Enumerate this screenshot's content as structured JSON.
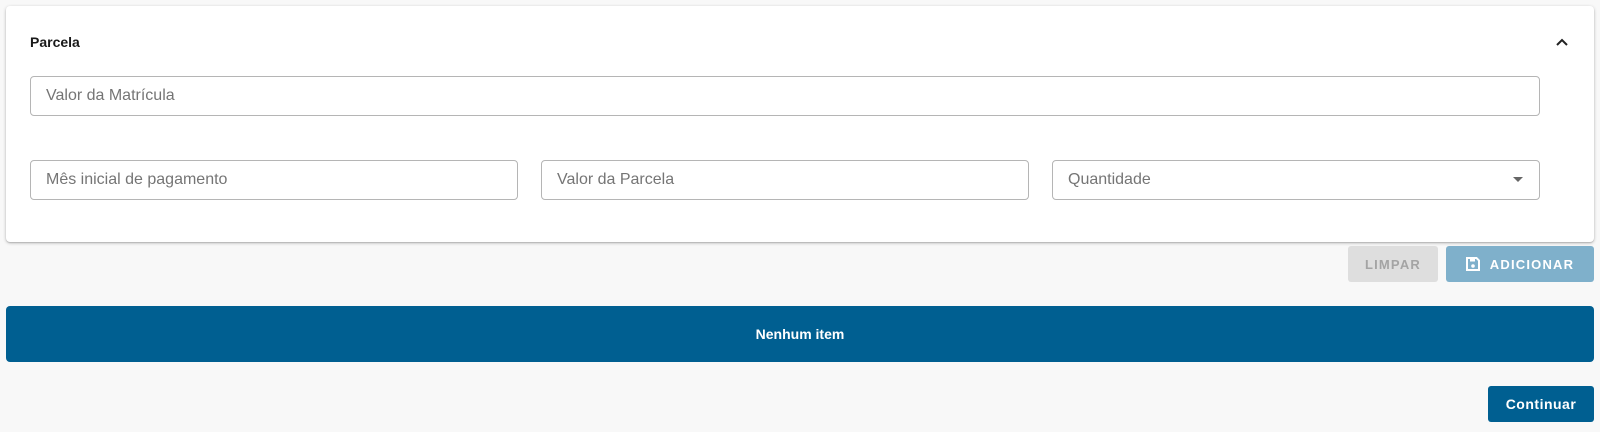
{
  "section": {
    "title": "Parcela",
    "collapse_icon": "chevron-up-icon"
  },
  "fields": {
    "valor_matricula": {
      "placeholder": "Valor da Matrícula",
      "value": ""
    },
    "mes_inicial": {
      "placeholder": "Mês inicial de pagamento",
      "value": ""
    },
    "valor_parcela": {
      "placeholder": "Valor da Parcela",
      "value": ""
    },
    "quantidade": {
      "placeholder": "Quantidade",
      "selected": ""
    }
  },
  "actions": {
    "limpar_label": "LIMPAR",
    "adicionar_label": "ADICIONAR",
    "adicionar_icon": "save-icon"
  },
  "list": {
    "empty_message": "Nenhum item"
  },
  "footer": {
    "continuar_label": "Continuar"
  },
  "colors": {
    "primary": "#005f91",
    "primary_disabled": "#7fb0cb",
    "button_disabled_bg": "#dedede",
    "page_bg": "#f8f8f8"
  }
}
